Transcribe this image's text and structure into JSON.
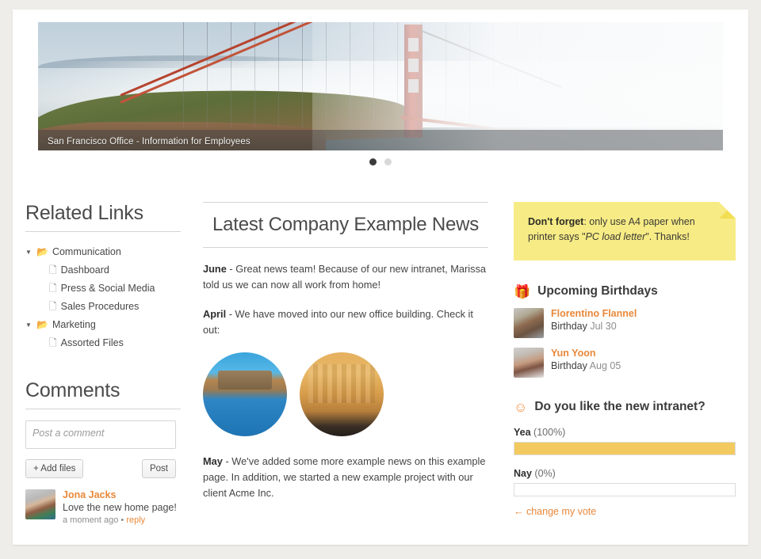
{
  "hero": {
    "caption": "San Francisco Office - Information for Employees",
    "dots": [
      {
        "label": "slide-1",
        "active": true
      },
      {
        "label": "slide-2",
        "active": false
      }
    ]
  },
  "sidebar_left": {
    "related_links_title": "Related Links",
    "tree": [
      {
        "label": "Communication",
        "type": "folder",
        "caret": "▼",
        "icon": "folder-icon"
      },
      {
        "label": "Dashboard",
        "type": "file",
        "icon": "file-icon"
      },
      {
        "label": "Press & Social Media",
        "type": "file",
        "icon": "file-icon"
      },
      {
        "label": "Sales Procedures",
        "type": "file",
        "icon": "file-icon"
      },
      {
        "label": "Marketing",
        "type": "folder",
        "caret": "▼",
        "icon": "folder-icon"
      },
      {
        "label": "Assorted Files",
        "type": "file",
        "icon": "file-icon"
      }
    ],
    "comments_title": "Comments",
    "comment_placeholder": "Post a comment",
    "comment_value": "",
    "add_files_label": "+ Add files",
    "post_label": "Post",
    "comment": {
      "author": "Jona Jacks",
      "text": "Love the new home page!",
      "time": "a moment ago",
      "separator": "•",
      "reply_label": "reply"
    }
  },
  "main": {
    "title": "Latest Company Example News",
    "posts": [
      {
        "month": "June",
        "dash": " - ",
        "body": "Great news team! Because of our new intranet, Marissa told us we can now all work from home!"
      },
      {
        "month": "April",
        "dash": " - ",
        "body": "We have moved into our new office building. Check it out:"
      },
      {
        "month": "May",
        "dash": " - ",
        "body": "We've added some more example news on this example page. In addition, we started a new example project with our client Acme Inc."
      }
    ],
    "images": [
      {
        "alt": "museum-reflection-photo"
      },
      {
        "alt": "wooden-auditorium-photo"
      }
    ]
  },
  "sidebar_right": {
    "note": {
      "lead": "Don't forget",
      "mid": ": only use A4 paper when printer says \"",
      "emphasis": "PC load letter",
      "tail": "\". Thanks!"
    },
    "birthdays_title": "Upcoming Birthdays",
    "birthdays_icon": "gift-icon",
    "birthdays": [
      {
        "name": "Florentino Flannel",
        "label": "Birthday",
        "date": "Jul 30"
      },
      {
        "name": "Yun Yoon",
        "label": "Birthday",
        "date": "Aug 05"
      }
    ],
    "poll": {
      "icon": "smiley-icon",
      "question": "Do you like the new intranet?",
      "options": [
        {
          "label": "Yea",
          "percent_text": "(100%)",
          "percent": 100
        },
        {
          "label": "Nay",
          "percent_text": "(0%)",
          "percent": 0
        }
      ],
      "change_vote": "← change my vote"
    }
  },
  "colors": {
    "accent_orange": "#e8883a",
    "note_yellow": "#f7eb85",
    "poll_yellow": "#f3ca5f",
    "page_bg": "#efedea"
  }
}
